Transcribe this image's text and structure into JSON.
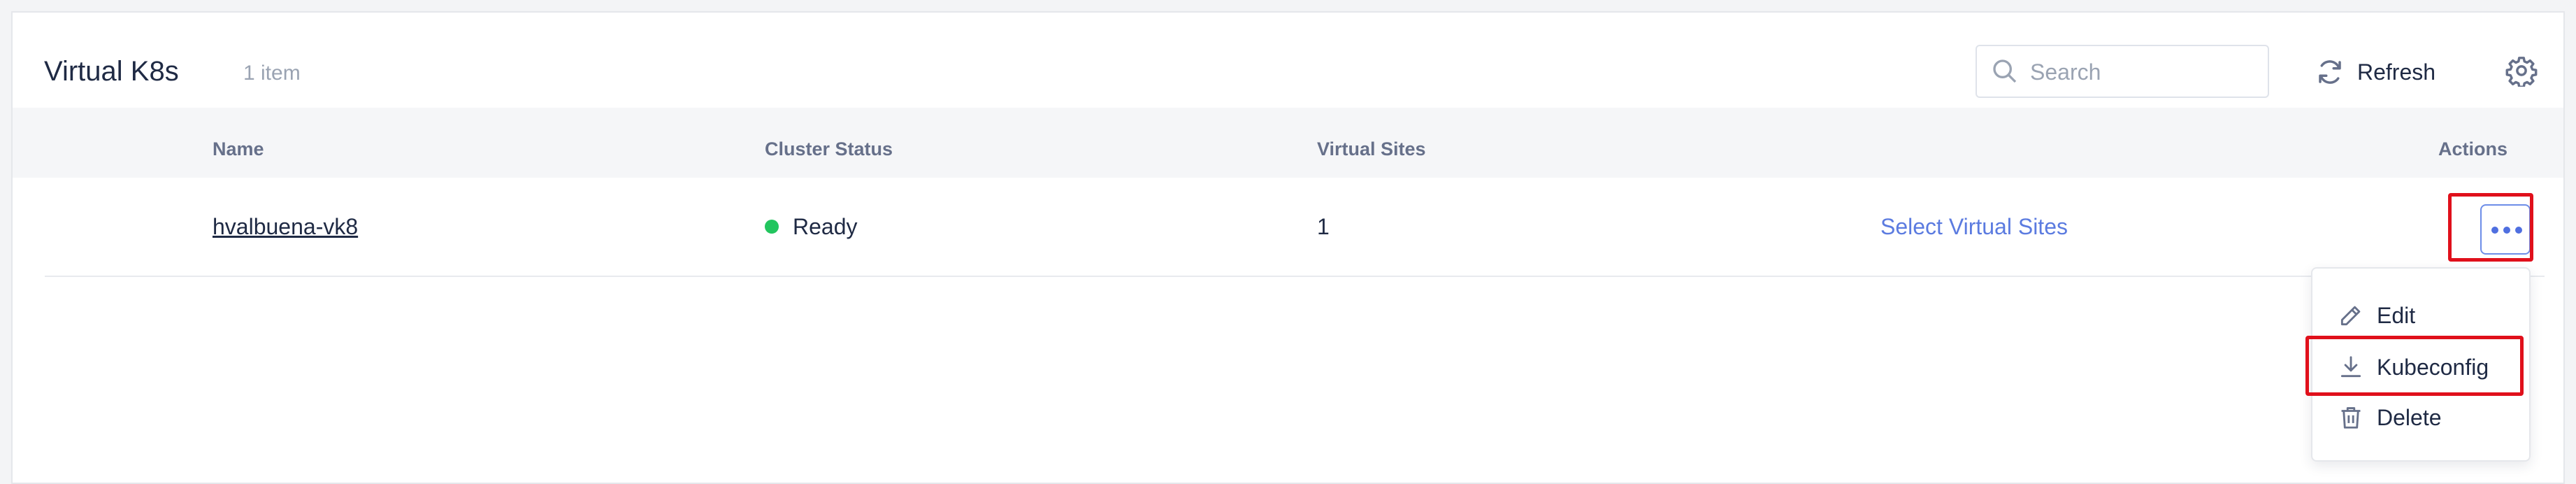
{
  "header": {
    "title": "Virtual K8s",
    "count": "1 item",
    "search_placeholder": "Search",
    "refresh_label": "Refresh"
  },
  "table": {
    "columns": [
      "Name",
      "Cluster Status",
      "Virtual Sites",
      "Actions"
    ],
    "rows": [
      {
        "name": "hvalbuena-vk8",
        "status": "Ready",
        "virtual_sites": "1",
        "select_link": "Select Virtual Sites"
      }
    ]
  },
  "actions_menu": {
    "items": [
      "Edit",
      "Kubeconfig",
      "Delete"
    ]
  },
  "colors": {
    "accent": "#5b7be0",
    "status_ready": "#22c55e",
    "highlight": "#e0101b"
  },
  "icons": [
    "search-icon",
    "refresh-icon",
    "gear-icon",
    "more-icon",
    "pencil-icon",
    "download-icon",
    "trash-icon"
  ]
}
